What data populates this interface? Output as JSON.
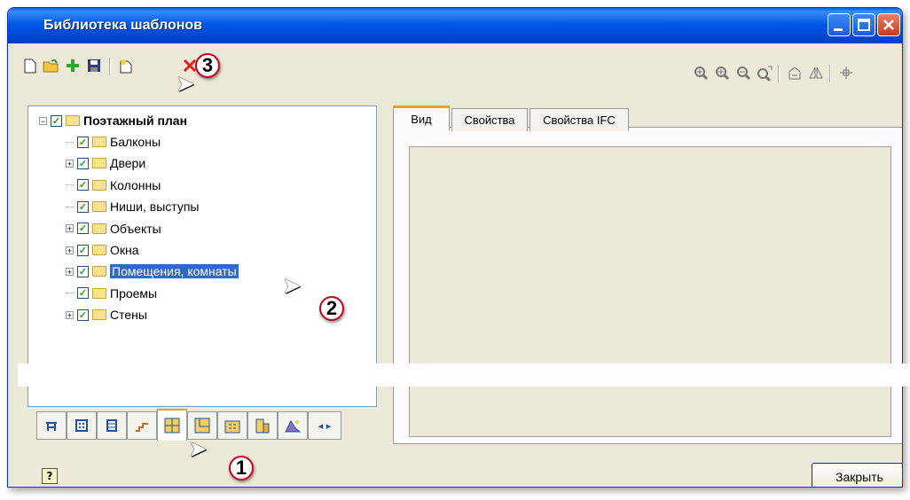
{
  "window": {
    "title": "Библиотека шаблонов",
    "accent": "#0058e6"
  },
  "toolbar": {
    "left_icons": [
      "new-icon",
      "open-icon",
      "add-icon",
      "save-icon",
      "new-template-icon",
      "delete-icon"
    ],
    "right_icons": [
      "zoom-window-icon",
      "zoom-in-icon",
      "zoom-out-icon",
      "zoom-all-icon",
      "rotate-icon",
      "mirror-icon",
      "center-icon"
    ]
  },
  "tree": {
    "root": {
      "label": "Поэтажный план",
      "checked": true,
      "expanded": true
    },
    "items": [
      {
        "label": "Балконы",
        "expandable": false
      },
      {
        "label": "Двери",
        "expandable": true
      },
      {
        "label": "Колонны",
        "expandable": false
      },
      {
        "label": "Ниши, выступы",
        "expandable": false
      },
      {
        "label": "Объекты",
        "expandable": true
      },
      {
        "label": "Окна",
        "expandable": true
      },
      {
        "label": "Помещения, комнаты",
        "expandable": true,
        "selected": true
      },
      {
        "label": "Проемы",
        "expandable": false
      },
      {
        "label": "Стены",
        "expandable": true
      }
    ]
  },
  "right_tabs": [
    "Вид",
    "Свойства",
    "Свойства IFC"
  ],
  "callouts": [
    "1",
    "2",
    "3"
  ],
  "footer": {
    "close_label": "Закрыть",
    "help_glyph": "?"
  },
  "expander_glyph": "+",
  "checkmark": "✓"
}
